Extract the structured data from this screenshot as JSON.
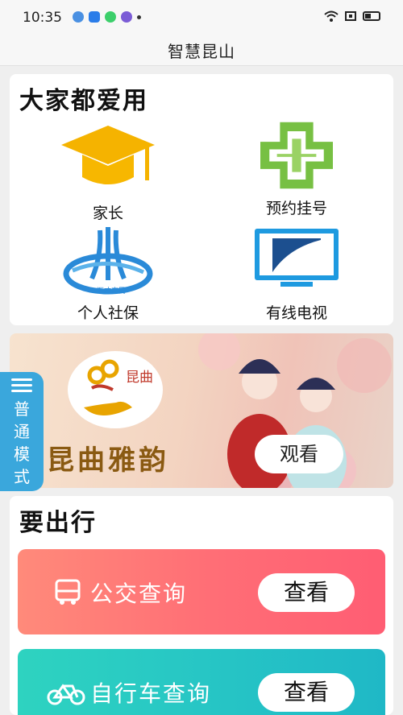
{
  "status_bar": {
    "time": "10:35"
  },
  "header": {
    "title": "智慧昆山"
  },
  "favorites": {
    "title": "大家都爱用",
    "items": [
      {
        "label": "家长",
        "icon": "graduation-cap-icon"
      },
      {
        "label": "预约挂号",
        "icon": "medical-cross-icon"
      },
      {
        "label": "个人社保",
        "icon": "social-security-logo-icon"
      },
      {
        "label": "有线电视",
        "icon": "tv-icon"
      }
    ]
  },
  "banner": {
    "logo_text": "昆曲",
    "title": "昆曲雅韵",
    "button": "观看"
  },
  "side_tab": {
    "label": "普通模式"
  },
  "travel": {
    "title": "要出行",
    "items": [
      {
        "label": "公交查询",
        "button": "查看",
        "icon": "bus-icon",
        "color": "#ff6f76"
      },
      {
        "label": "自行车查询",
        "button": "查看",
        "icon": "bicycle-icon",
        "color": "#27c6c5"
      }
    ]
  },
  "colors": {
    "accent_blue": "#3aa7dc",
    "bus_red": "#ff6f76",
    "bike_teal": "#27c6c5"
  }
}
